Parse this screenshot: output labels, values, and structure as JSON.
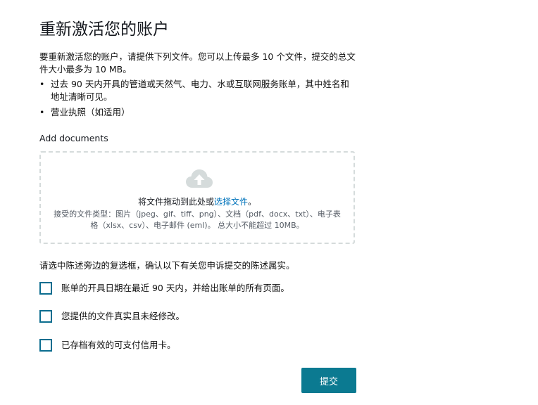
{
  "header": {
    "title": "重新激活您的账户"
  },
  "intro": {
    "text": "要重新激活您的账户，请提供下列文件。您可以上传最多 10 个文件，提交的总文件大小最多为 10 MB。"
  },
  "requirements": {
    "items": [
      {
        "bullet": "•",
        "text": "过去 90 天内开具的管道或天然气、电力、水或互联网服务账单，其中姓名和地址清晰可见。"
      },
      {
        "bullet": "•",
        "text": "营业执照（如适用）"
      }
    ]
  },
  "upload": {
    "label": "Add documents",
    "icon": "cloud-upload-icon",
    "drop_text": "将文件拖动到此处或",
    "choose_link": "选择文件",
    "drop_suffix": "。",
    "types_text": "接受的文件类型：图片（jpeg、gif、tiff、png）、文档（pdf、docx、txt）、电子表格（xlsx、csv）、电子邮件 (eml)。 总大小不能超过 10MB。"
  },
  "confirm": {
    "instruction": "请选中陈述旁边的复选框，确认以下有关您申诉提交的陈述属实。",
    "checkboxes": [
      {
        "label": "账单的开具日期在最近 90 天内，并给出账单的所有页面。",
        "checked": false
      },
      {
        "label": "您提供的文件真实且未经修改。",
        "checked": false
      },
      {
        "label": "已存档有效的可支付信用卡。",
        "checked": false
      }
    ]
  },
  "actions": {
    "submit_label": "提交"
  },
  "colors": {
    "accent": "#0b7a91",
    "link": "#0073bb",
    "checkbox_border": "#0b6d8f",
    "dropzone_border": "#d5dbdb",
    "icon": "#d5dbdb"
  }
}
